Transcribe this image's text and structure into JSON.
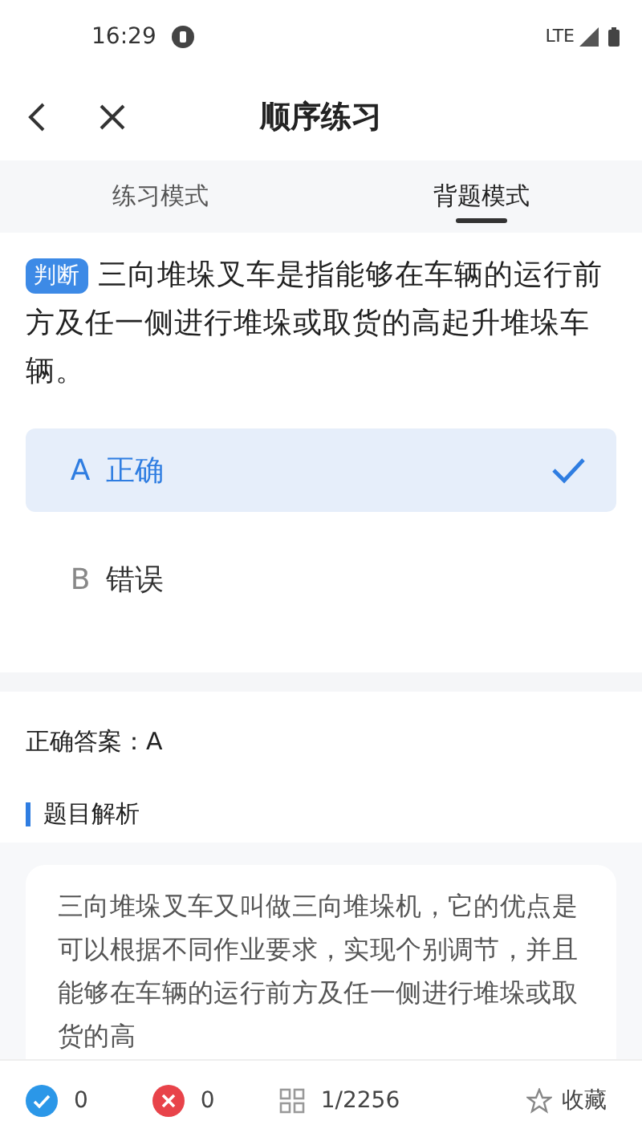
{
  "status_bar": {
    "time": "16:29",
    "network": "LTE"
  },
  "header": {
    "title": "顺序练习"
  },
  "tabs": [
    {
      "label": "练习模式",
      "selected": false
    },
    {
      "label": "背题模式",
      "selected": true
    }
  ],
  "question": {
    "type_tag": "判断",
    "text": "三向堆垛叉车是指能够在车辆的运行前方及任一侧进行堆垛或取货的高起升堆垛车辆。"
  },
  "options": [
    {
      "letter": "A",
      "text": "正确",
      "selected": true
    },
    {
      "letter": "B",
      "text": "错误",
      "selected": false
    }
  ],
  "answer": "正确答案：A",
  "analysis": {
    "heading": "题目解析",
    "text": "三向堆垛叉车又叫做三向堆垛机，它的优点是可以根据不同作业要求，实现个别调节，并且能够在车辆的运行前方及任一侧进行堆垛或取货的高"
  },
  "bottom_bar": {
    "correct_count": "0",
    "wrong_count": "0",
    "progress": "1/2256",
    "favorite": "收藏"
  }
}
